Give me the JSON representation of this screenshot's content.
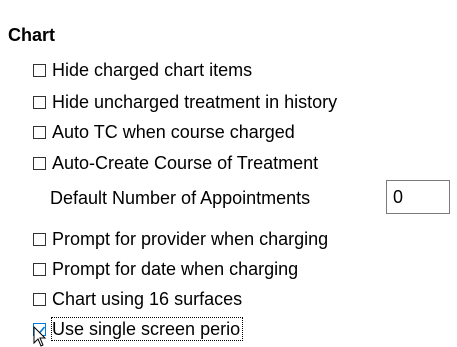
{
  "section": {
    "title": "Chart"
  },
  "options": [
    {
      "label": "Hide charged chart items",
      "checked": false
    },
    {
      "label": "Hide uncharged treatment in history",
      "checked": false
    },
    {
      "label": "Auto TC when course charged",
      "checked": false
    },
    {
      "label": "Auto-Create Course of Treatment",
      "checked": false
    }
  ],
  "appointments": {
    "label": "Default Number of Appointments",
    "value": "0"
  },
  "options2": [
    {
      "label": "Prompt for provider when charging",
      "checked": false
    },
    {
      "label": "Prompt for date when charging",
      "checked": false
    },
    {
      "label": "Chart using 16 surfaces",
      "checked": false
    },
    {
      "label": "Use single screen perio",
      "checked": true
    }
  ],
  "colors": {
    "check_accent": "#0078d7",
    "box_border": "#333333"
  },
  "icons": {
    "cursor": "mouse-pointer-icon"
  }
}
